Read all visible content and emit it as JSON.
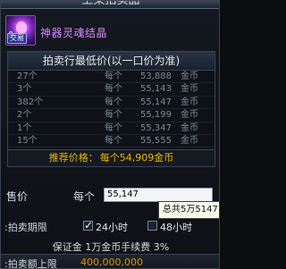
{
  "window": {
    "title": "上架拍卖品"
  },
  "item": {
    "name": "神器灵魂结晶",
    "trade_badge": "交易"
  },
  "price_table": {
    "header": "拍卖行最低价(以一口价为准)",
    "rows": [
      {
        "qty": "27个",
        "each": "每个",
        "price": "53,888",
        "currency": "金币"
      },
      {
        "qty": "3个",
        "each": "每个",
        "price": "55,143",
        "currency": "金币"
      },
      {
        "qty": "382个",
        "each": "每个",
        "price": "55,147",
        "currency": "金币"
      },
      {
        "qty": "2个",
        "each": "每个",
        "price": "55,199",
        "currency": "金币"
      },
      {
        "qty": "1个",
        "each": "每个",
        "price": "55,347",
        "currency": "金币"
      },
      {
        "qty": "15个",
        "each": "每个",
        "price": "55,555",
        "currency": "金币"
      }
    ],
    "recommend_label": "推荐价格：",
    "recommend_value": "每个54,909金币"
  },
  "form": {
    "price_label": "售价",
    "each_label": "每个",
    "price_value": "55,147",
    "tooltip": "总共5万5147",
    "duration_label": ":拍卖期限",
    "option_24h": "24小时",
    "option_48h": "48小时",
    "deposit_text": "保证金 1万金币手续费 3%",
    "limit_label": ":拍卖额上限",
    "limit_value": "400,000,000"
  }
}
